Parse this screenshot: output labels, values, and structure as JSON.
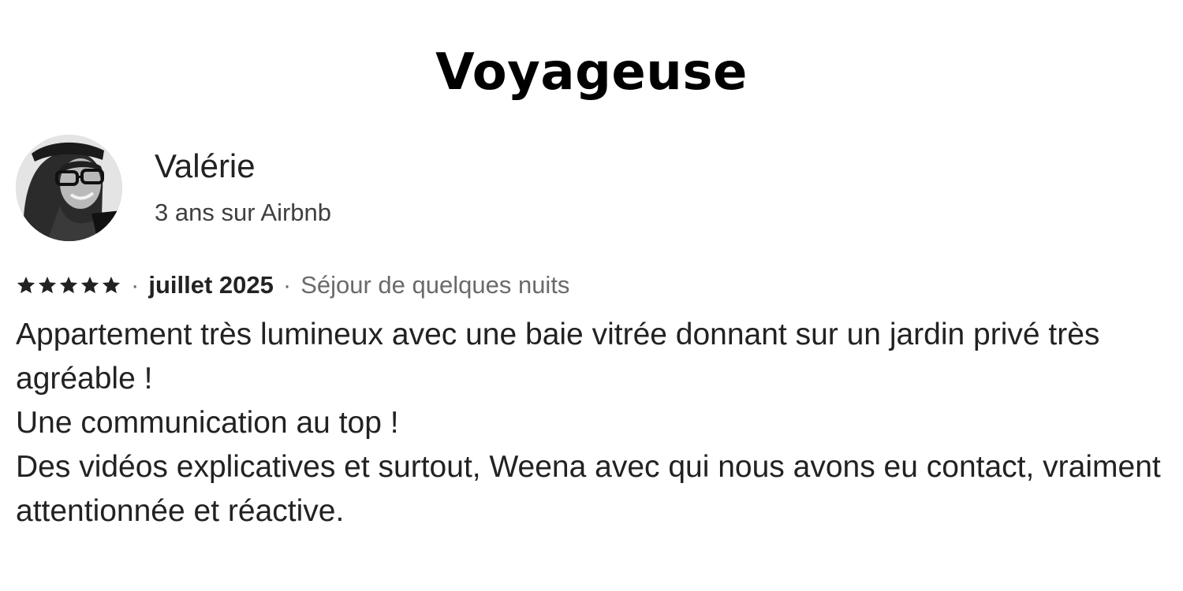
{
  "heading": "Voyageuse",
  "reviewer": {
    "name": "Valérie",
    "tenure": "3 ans sur Airbnb",
    "avatar_icon": "person-photo-icon"
  },
  "review": {
    "rating": 5,
    "rating_max": 5,
    "star_color": "#222222",
    "separator": "·",
    "date": "juillet 2025",
    "stay_type": "Séjour de quelques nuits",
    "lines": [
      "Appartement très lumineux avec une baie vitrée donnant sur un jardin privé très agréable !",
      "Une communication au top !",
      "Des vidéos explicatives et surtout, Weena avec qui nous avons eu contact, vraiment attentionnée et réactive."
    ]
  }
}
